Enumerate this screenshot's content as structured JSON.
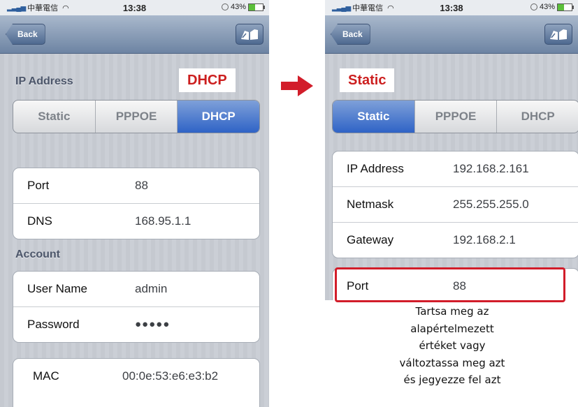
{
  "status_bar": {
    "carrier": "中華電信",
    "time": "13:38",
    "battery": "43%",
    "battery_level": 0.43
  },
  "nav": {
    "back_label": "Back",
    "right_icon": "book-icon"
  },
  "left_screen": {
    "section_title": "IP Address",
    "mode_tag": "DHCP",
    "segments": [
      "Static",
      "PPPOE",
      "DHCP"
    ],
    "active_segment": "DHCP",
    "port_group": [
      {
        "label": "Port",
        "value": "88"
      },
      {
        "label": "DNS",
        "value": "168.95.1.1"
      }
    ],
    "account_title": "Account",
    "account_group": [
      {
        "label": "User Name",
        "value": "admin"
      },
      {
        "label": "Password",
        "value": "●●●●●"
      }
    ],
    "mac_group": [
      {
        "label": "MAC",
        "value": "00:0e:53:e6:e3:b2"
      }
    ]
  },
  "right_screen": {
    "mode_tag": "Static",
    "segments": [
      "Static",
      "PPPOE",
      "DHCP"
    ],
    "active_segment": "Static",
    "ip_group": [
      {
        "label": "IP Address",
        "value": "192.168.2.161"
      },
      {
        "label": "Netmask",
        "value": "255.255.255.0"
      },
      {
        "label": "Gateway",
        "value": "192.168.2.1"
      }
    ],
    "port_group": [
      {
        "label": "Port",
        "value": "88"
      }
    ]
  },
  "note_lines": [
    "Tartsa meg az",
    "alapértelmezett",
    "értéket vagy",
    "változtassa meg azt",
    "és jegyezze fel azt"
  ],
  "colors": {
    "accent_red": "#cc1f1f",
    "segment_active": "#2f63c6",
    "nav_bar": "#6d84a3"
  }
}
